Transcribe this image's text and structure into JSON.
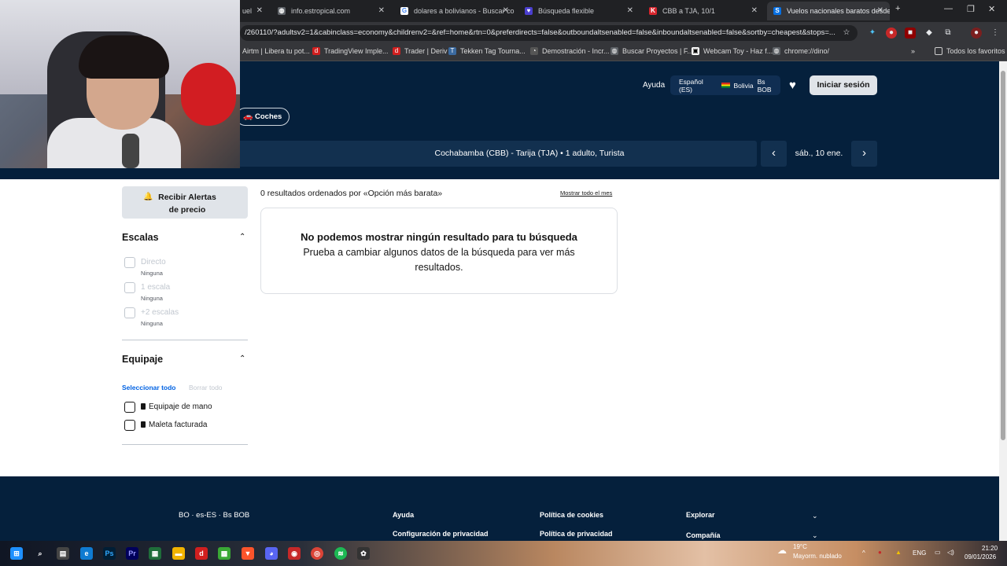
{
  "browser": {
    "tabs": [
      {
        "label": "uel",
        "close": "✕"
      },
      {
        "label": "info.estropical.com",
        "close": "✕"
      },
      {
        "label": "dolares a bolivianos - Buscar co",
        "close": "✕"
      },
      {
        "label": "Búsqueda flexible",
        "close": "✕"
      },
      {
        "label": "CBB a TJA, 10/1",
        "close": "✕"
      },
      {
        "label": "Vuelos nacionales baratos desde",
        "close": "✕"
      }
    ],
    "new_tab": "+",
    "url": "/260110/?adultsv2=1&cabinclass=economy&childrenv2=&ref=home&rtn=0&preferdirects=false&outboundaltsenabled=false&inboundaltsenabled=false&sortby=cheapest&stops=...",
    "bookmarks": [
      "Airtm | Libera tu pot...",
      "TradingView Imple...",
      "Trader | Deriv",
      "Tekken Tag Tourna...",
      "Demostración - Incr...",
      "Buscar Proyectos | F...",
      "Webcam Toy - Haz f...",
      "chrome://dino/"
    ],
    "bookmarks_more": "»",
    "all_bookmarks": "Todos los favoritos"
  },
  "header": {
    "help": "Ayuda",
    "locale": {
      "language": "Español (ES)",
      "country": "Bolivia",
      "currency": "Bs BOB"
    },
    "login": "Iniciar sesión",
    "cars_tab": "Coches",
    "search_summary": "Cochabamba (CBB) - Tarija (TJA)  •  1 adulto, Turista",
    "date": "sáb., 10 ene."
  },
  "sidebar": {
    "price_alerts": "Recibir Alertas de precio",
    "stops": {
      "title": "Escalas",
      "options": [
        {
          "label": "Directo",
          "sub": "Ninguna"
        },
        {
          "label": "1 escala",
          "sub": "Ninguna"
        },
        {
          "label": "+2 escalas",
          "sub": "Ninguna"
        }
      ]
    },
    "baggage": {
      "title": "Equipaje",
      "select_all": "Seleccionar todo",
      "clear_all": "Borrar todo",
      "options": [
        "Equipaje de mano",
        "Maleta facturada"
      ]
    }
  },
  "results": {
    "count_text": "0 resultados ordenados por «Opción más barata»",
    "show_month": "Mostrar todo el mes",
    "empty_title": "No podemos mostrar ningún resultado para tu búsqueda",
    "empty_body": "Prueba a cambiar algunos datos de la búsqueda para ver más resultados."
  },
  "footer": {
    "locale": "BO · es-ES · Bs BOB",
    "links_col1": [
      "Ayuda",
      "Configuración de privacidad"
    ],
    "links_col2": [
      "Política de cookies",
      "Política de privacidad"
    ],
    "links_col3": [
      "Explorar",
      "Compañía"
    ]
  },
  "taskbar": {
    "weather_temp": "19°C",
    "weather_desc": "Mayorm. nublado",
    "lang": "ENG",
    "time": "21:20",
    "date": "09/01/2026"
  },
  "colors": {
    "brand_navy": "#05203c",
    "link_blue": "#0062e3"
  }
}
